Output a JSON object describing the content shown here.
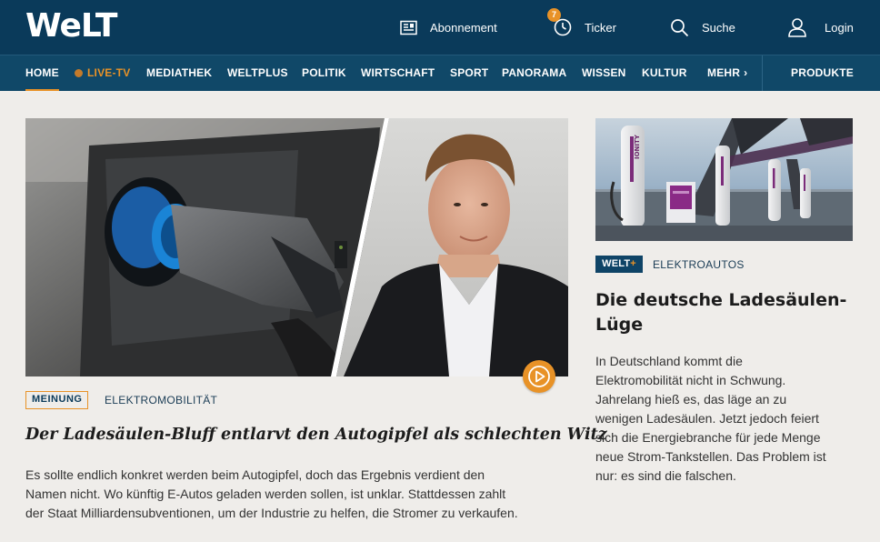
{
  "header": {
    "logo": "Welt",
    "abonnement_label": "Abonnement",
    "ticker_label": "Ticker",
    "ticker_badge": "7",
    "search_label": "Suche",
    "login_label": "Login"
  },
  "nav": {
    "items": [
      {
        "label": "HOME"
      },
      {
        "label": "LIVE-TV"
      },
      {
        "label": "MEDIATHEK"
      },
      {
        "label": "WELTPLUS"
      },
      {
        "label": "POLITIK"
      },
      {
        "label": "WIRTSCHAFT"
      },
      {
        "label": "SPORT"
      },
      {
        "label": "PANORAMA"
      },
      {
        "label": "WISSEN"
      },
      {
        "label": "KULTUR"
      },
      {
        "label": "MEHR"
      }
    ],
    "produkte_label": "PRODUKTE",
    "active_index": 0
  },
  "main_article": {
    "tag": "MEINUNG",
    "kicker": "ELEKTROMOBILITÄT",
    "headline": "Der Ladesäulen-Bluff entlarvt den Autogipfel als schlechten Witz",
    "teaser_lines": [
      "Es sollte endlich konkret werden beim Autogipfel, doch das Ergebnis verdient den",
      "Namen nicht. Wo künftig E-Autos geladen werden sollen, ist unklar. Stattdessen zahlt",
      "der Staat Milliardensubventionen, um der Industrie zu helfen, die Stromer zu verkaufen."
    ]
  },
  "side_article": {
    "badge_main": "WELT",
    "badge_plus": "+",
    "kicker": "ELEKTROAUTOS",
    "headline_lines": [
      "Die deutsche Ladesäulen-",
      "Lüge"
    ],
    "teaser_lines": [
      "In Deutschland kommt die",
      "Elektromobilität nicht in Schwung.",
      "Jahrelang hieß es, das läge an zu",
      "wenigen Ladesäulen. Jetzt jedoch feiert",
      "sich die Energiebranche für jede Menge",
      "neue Strom-Tankstellen. Das Problem ist",
      "nur: es sind die falschen."
    ],
    "image_brand_text": "IONITY"
  },
  "colors": {
    "header_bg": "#0a3a5a",
    "nav_bg": "#104868",
    "accent_orange": "#e89227",
    "page_bg": "#efedea"
  }
}
